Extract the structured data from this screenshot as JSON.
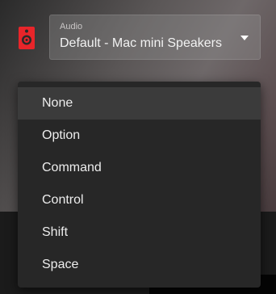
{
  "audio": {
    "label": "Audio",
    "value": "Default - Mac mini Speakers",
    "speaker_icon": "speaker-icon",
    "caret_icon": "caret-down-icon"
  },
  "colors": {
    "icon_red": "#e8252a",
    "menu_bg": "#272727",
    "menu_selected": "#3b3b3b"
  },
  "menu": {
    "items": [
      {
        "label": "None",
        "selected": true
      },
      {
        "label": "Option",
        "selected": false
      },
      {
        "label": "Command",
        "selected": false
      },
      {
        "label": "Control",
        "selected": false
      },
      {
        "label": "Shift",
        "selected": false
      },
      {
        "label": "Space",
        "selected": false
      }
    ]
  }
}
